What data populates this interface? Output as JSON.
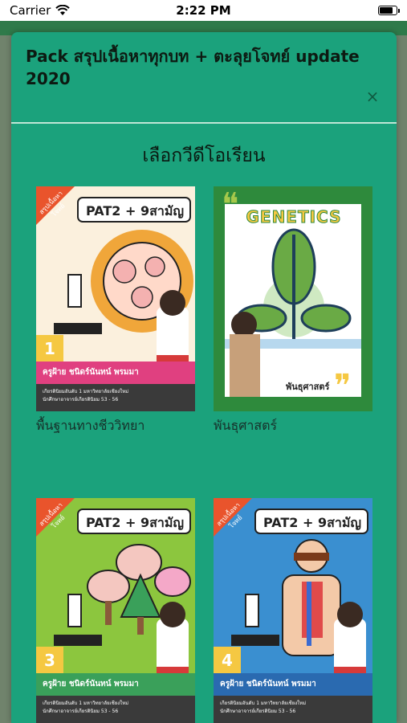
{
  "status_bar": {
    "carrier": "Carrier",
    "time": "2:22 PM",
    "battery_level": 0.85
  },
  "modal": {
    "title": "Pack สรุปเนื้อหาทุกบท + ตะลุยโจทย์ update 2020",
    "close_label": "×",
    "subtitle": "เลือกวีดีโอเรียน"
  },
  "videos": [
    {
      "caption": "พื้นฐานทางชีววิทยา",
      "ribbon": "สรุปเนื้อหา โจทย์",
      "header": "PAT2 + 9สามัญ",
      "number": "1",
      "teacher": "ครูฝ้าย ชนิดร์นันทน์ พรมมา",
      "teacher_sub": "เกียรตินิยมอันดับ 1 มหาวิทยาลัยเชียงใหม่",
      "teacher_sub2": "นักศึกษาอาจารย์เกียรตินิยม 53 - 56",
      "accent": "#f0a63a"
    },
    {
      "caption": "พันธุศาสตร์",
      "cover_title": "GENETICS",
      "cover_label": "พันธุศาสตร์",
      "accent": "#2e8a3c"
    },
    {
      "caption": "",
      "ribbon": "สรุปเนื้อหา โจทย์",
      "header": "PAT2 + 9สามัญ",
      "number": "3",
      "teacher": "ครูฝ้าย ชนิดร์นันทน์ พรมมา",
      "teacher_sub": "เกียรตินิยมอันดับ 1 มหาวิทยาลัยเชียงใหม่",
      "teacher_sub2": "นักศึกษาอาจารย์เกียรตินิยม 53 - 56",
      "accent": "#8cc63e"
    },
    {
      "caption": "",
      "ribbon": "สรุปเนื้อหา โจทย์",
      "header": "PAT2 + 9สามัญ",
      "number": "4",
      "teacher": "ครูฝ้าย ชนิดร์นันทน์ พรมมา",
      "teacher_sub": "เกียรตินิยมอันดับ 1 มหาวิทยาลัยเชียงใหม่",
      "teacher_sub2": "นักศึกษาอาจารย์เกียรตินิยม 53 - 56",
      "accent": "#3a8fd0"
    }
  ],
  "colors": {
    "modal_bg": "#1ba27c",
    "divider": "#bfe6d6"
  }
}
